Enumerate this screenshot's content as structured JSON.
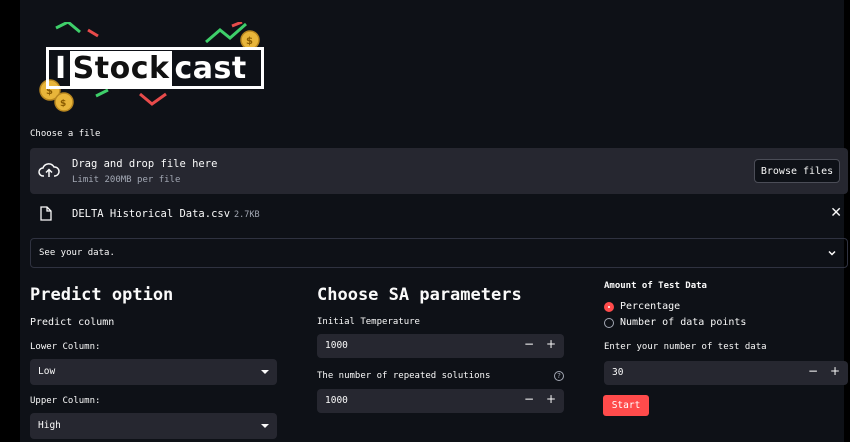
{
  "logo": {
    "pre": "I",
    "highlight": "Stock",
    "post": "cast"
  },
  "uploader": {
    "label": "Choose a file",
    "drop_title": "Drag and drop file here",
    "limit": "Limit 200MB per file",
    "browse_label": "Browse files",
    "icon": "cloud-upload-icon"
  },
  "file": {
    "name": "DELTA Historical Data.csv",
    "size": "2.7KB",
    "close": "✕"
  },
  "expander": {
    "label": "See your data."
  },
  "predict": {
    "heading": "Predict option",
    "sub": "Predict column",
    "lower_label": "Lower Column:",
    "lower_value": "Low",
    "upper_label": "Upper Column:",
    "upper_value": "High"
  },
  "sa": {
    "heading": "Choose SA parameters",
    "temp_label": "Initial Temperature",
    "temp_value": "1000",
    "repeat_label": "The number of repeated solutions",
    "repeat_value": "1000",
    "help": "?"
  },
  "test": {
    "heading": "Amount of Test Data",
    "options": [
      "Percentage",
      "Number of data points"
    ],
    "selected": "Percentage",
    "input_label": "Enter your number of test data",
    "input_value": "30",
    "start_label": "Start"
  },
  "stepper": {
    "minus": "−",
    "plus": "+"
  },
  "colors": {
    "background": "#0e1117",
    "widget": "#262730",
    "accent": "#ff4b4b"
  }
}
